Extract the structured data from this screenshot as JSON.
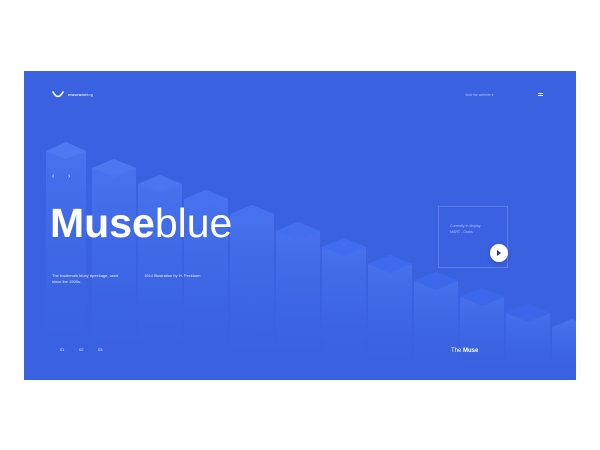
{
  "brand": {
    "logo_icon": "smile-arc-icon",
    "name_bold": "museum",
    "name_light": "blog"
  },
  "topbar": {
    "link_label": "Visit the website",
    "link_icon": "image-icon",
    "menu_icon": "hamburger-icon"
  },
  "nav": {
    "prev_icon": "chevron-left-icon",
    "next_icon": "chevron-right-icon"
  },
  "hero": {
    "title_bold": "Muse",
    "title_light": "blue",
    "desc_left_line1": "The trademark bluey dpeekage, used",
    "desc_left_line2": "since the 1900s.",
    "desc_right": "1914 Illustration by H. Peckham"
  },
  "card": {
    "title_prefix": "The ",
    "title_bold": "Muse",
    "sub_line1": "Currently in display",
    "sub_line2": "MART - Gratis",
    "play_icon": "play-icon"
  },
  "pager": {
    "items": [
      "01",
      "02",
      "03"
    ]
  },
  "colors": {
    "background": "#3a62e0",
    "prism_face": "#3b68ea",
    "prism_side": "#2f56d6",
    "text": "#ffffff"
  }
}
